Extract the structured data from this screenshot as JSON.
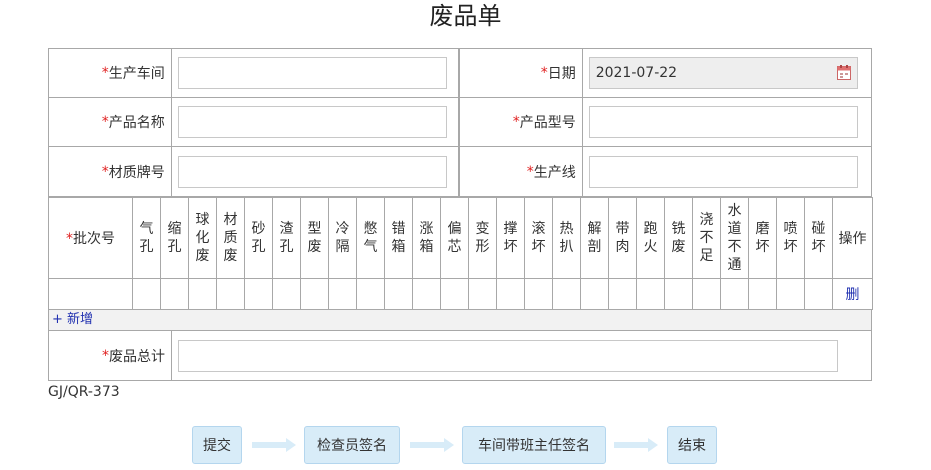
{
  "title": "废品单",
  "required_mark": "*",
  "fields": {
    "workshop_label": "生产车间",
    "date_label": "日期",
    "date_value": "2021-07-22",
    "product_name_label": "产品名称",
    "product_model_label": "产品型号",
    "material_label": "材质牌号",
    "line_label": "生产线",
    "total_label": "废品总计"
  },
  "table": {
    "batch_label": "批次号",
    "defects": [
      "气孔",
      "缩孔",
      "球化废",
      "材质废",
      "砂孔",
      "渣孔",
      "型废",
      "冷隔",
      "憋气",
      "错箱",
      "涨箱",
      "偏芯",
      "变形",
      "撑坏",
      "滚坏",
      "热扒",
      "解剖",
      "带肉",
      "跑火",
      "铣废",
      "浇不足",
      "水道不通",
      "磨坏",
      "喷坏",
      "碰坏"
    ],
    "action_label": "操作",
    "delete_label": "删",
    "add_label": "+ 新增"
  },
  "form_code": "GJ/QR-373",
  "flow": [
    "提交",
    "检查员签名",
    "车间带班主任签名",
    "结束"
  ]
}
